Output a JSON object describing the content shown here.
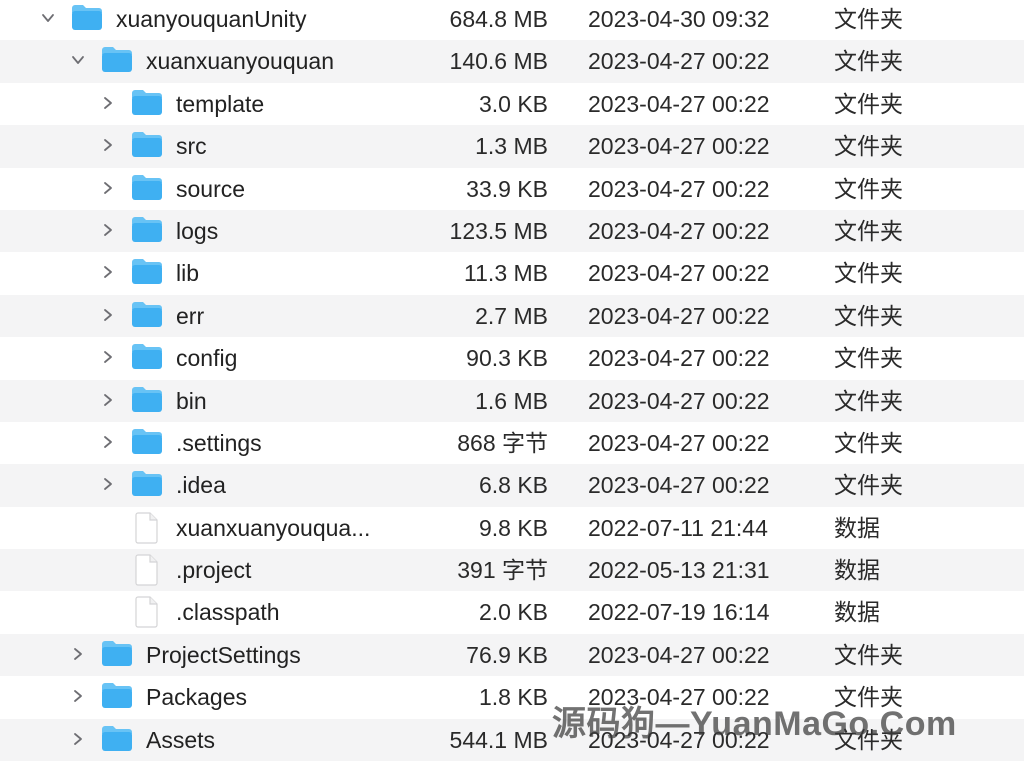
{
  "rows": [
    {
      "name": "xuanyouquanUnity",
      "size": "684.8 MB",
      "date": "2023-04-30 09:32",
      "kind": "文件夹",
      "type": "folder",
      "depth": 0,
      "expanded": true
    },
    {
      "name": "xuanxuanyouquan",
      "size": "140.6 MB",
      "date": "2023-04-27 00:22",
      "kind": "文件夹",
      "type": "folder",
      "depth": 1,
      "expanded": true
    },
    {
      "name": "template",
      "size": "3.0 KB",
      "date": "2023-04-27 00:22",
      "kind": "文件夹",
      "type": "folder",
      "depth": 2,
      "expanded": false
    },
    {
      "name": "src",
      "size": "1.3 MB",
      "date": "2023-04-27 00:22",
      "kind": "文件夹",
      "type": "folder",
      "depth": 2,
      "expanded": false
    },
    {
      "name": "source",
      "size": "33.9 KB",
      "date": "2023-04-27 00:22",
      "kind": "文件夹",
      "type": "folder",
      "depth": 2,
      "expanded": false
    },
    {
      "name": "logs",
      "size": "123.5 MB",
      "date": "2023-04-27 00:22",
      "kind": "文件夹",
      "type": "folder",
      "depth": 2,
      "expanded": false
    },
    {
      "name": "lib",
      "size": "11.3 MB",
      "date": "2023-04-27 00:22",
      "kind": "文件夹",
      "type": "folder",
      "depth": 2,
      "expanded": false
    },
    {
      "name": "err",
      "size": "2.7 MB",
      "date": "2023-04-27 00:22",
      "kind": "文件夹",
      "type": "folder",
      "depth": 2,
      "expanded": false
    },
    {
      "name": "config",
      "size": "90.3 KB",
      "date": "2023-04-27 00:22",
      "kind": "文件夹",
      "type": "folder",
      "depth": 2,
      "expanded": false
    },
    {
      "name": "bin",
      "size": "1.6 MB",
      "date": "2023-04-27 00:22",
      "kind": "文件夹",
      "type": "folder",
      "depth": 2,
      "expanded": false
    },
    {
      "name": ".settings",
      "size": "868 字节",
      "date": "2023-04-27 00:22",
      "kind": "文件夹",
      "type": "folder",
      "depth": 2,
      "expanded": false
    },
    {
      "name": ".idea",
      "size": "6.8 KB",
      "date": "2023-04-27 00:22",
      "kind": "文件夹",
      "type": "folder",
      "depth": 2,
      "expanded": false
    },
    {
      "name": "xuanxuanyouqua...",
      "size": "9.8 KB",
      "date": "2022-07-11 21:44",
      "kind": "数据",
      "type": "file",
      "depth": 2
    },
    {
      "name": ".project",
      "size": "391 字节",
      "date": "2022-05-13 21:31",
      "kind": "数据",
      "type": "file",
      "depth": 2
    },
    {
      "name": ".classpath",
      "size": "2.0 KB",
      "date": "2022-07-19 16:14",
      "kind": "数据",
      "type": "file",
      "depth": 2
    },
    {
      "name": "ProjectSettings",
      "size": "76.9 KB",
      "date": "2023-04-27 00:22",
      "kind": "文件夹",
      "type": "folder",
      "depth": 1,
      "expanded": false
    },
    {
      "name": "Packages",
      "size": "1.8 KB",
      "date": "2023-04-27 00:22",
      "kind": "文件夹",
      "type": "folder",
      "depth": 1,
      "expanded": false
    },
    {
      "name": "Assets",
      "size": "544.1 MB",
      "date": "2023-04-27 00:22",
      "kind": "文件夹",
      "type": "folder",
      "depth": 1,
      "expanded": false
    }
  ],
  "watermark": "源码狗—YuanMaGo.Com",
  "colors": {
    "folder": "#3fb0f2",
    "folder_tab": "#68c3f5",
    "alt_row": "#f4f4f5",
    "chevron": "#6e6e73"
  }
}
